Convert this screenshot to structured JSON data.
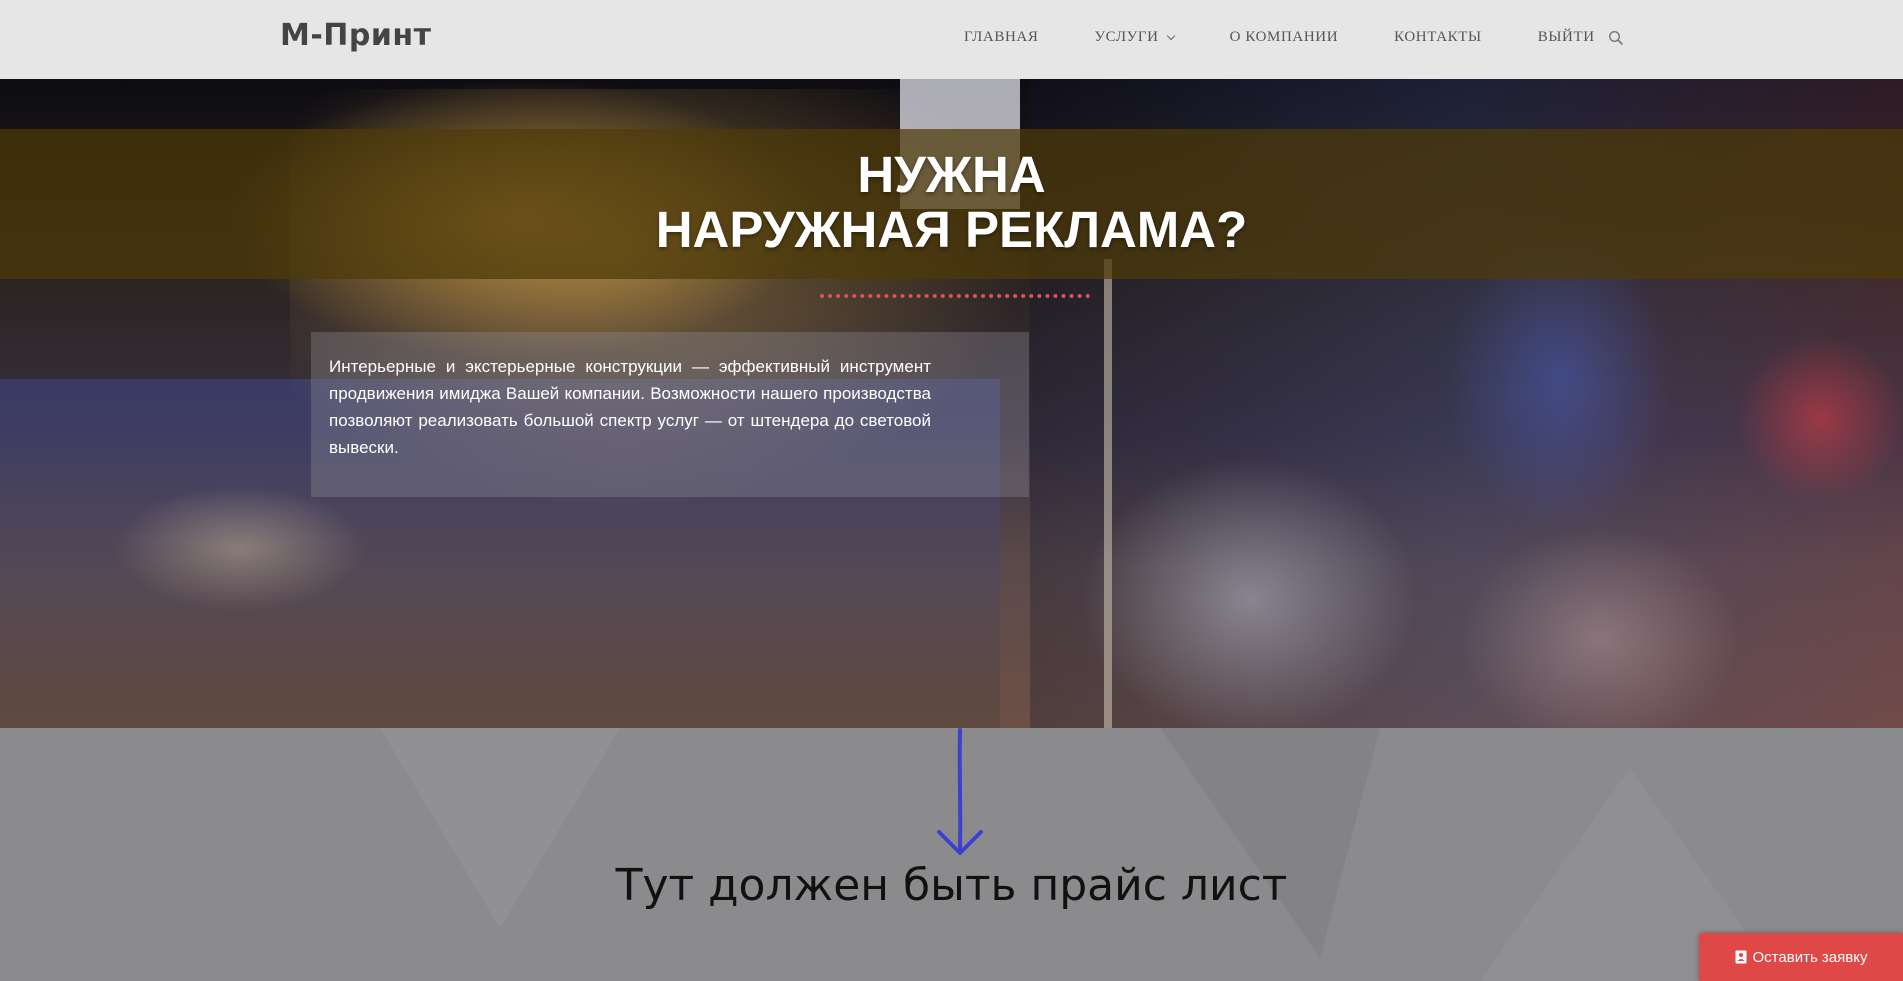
{
  "header": {
    "logo": "М-Принт",
    "nav": [
      {
        "label": "ГЛАВНАЯ"
      },
      {
        "label": "УСЛУГИ",
        "has_dropdown": true
      },
      {
        "label": "О КОМПАНИИ"
      },
      {
        "label": "КОНТАКТЫ"
      },
      {
        "label": "ВЫЙТИ"
      }
    ],
    "search_icon": "search-icon"
  },
  "hero": {
    "title_line1": "НУЖНА",
    "title_line2": "НАРУЖНАЯ РЕКЛАМА?",
    "description": "Интерьерные и экстерьерные конструкции — эффективный инструмент продвижения имиджа Вашей компании. Возможности нашего производства позволяют реализовать большой спектр услуг — от штендера до световой вывески."
  },
  "annotation": {
    "arrow_icon": "arrow-down-icon",
    "text": "Тут должен быть прайс лист"
  },
  "cta": {
    "label": "Оставить заявку",
    "icon": "document-icon"
  },
  "colors": {
    "header_bg": "#e6e6e6",
    "title_band": "#4e3a08",
    "accent_red": "#e04848",
    "arrow_blue": "#3d3fd0",
    "dotted_line": "#d8545a"
  }
}
